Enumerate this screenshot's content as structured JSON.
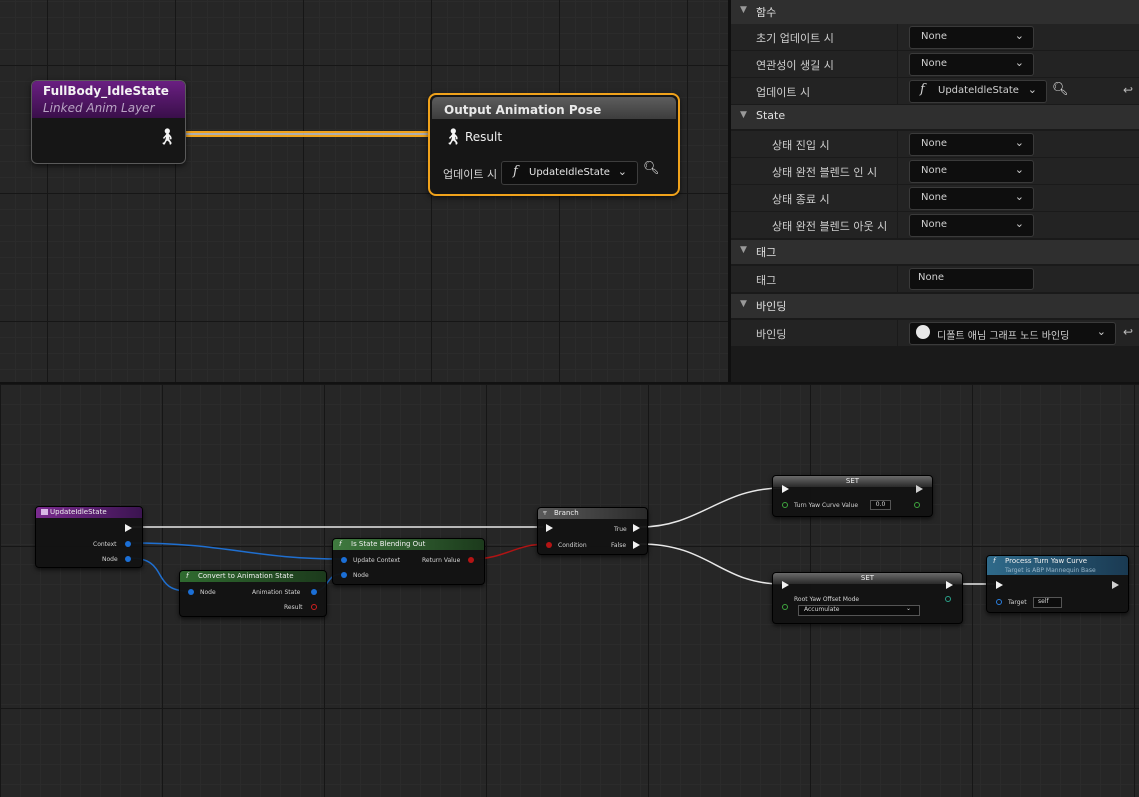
{
  "details": {
    "functions": {
      "section": "함수",
      "rows": [
        {
          "label": "초기 업데이트 시",
          "value": "None"
        },
        {
          "label": "연관성이 생길 시",
          "value": "None"
        },
        {
          "label": "업데이트 시",
          "value": "UpdateIdleState"
        }
      ]
    },
    "state": {
      "section": "State",
      "rows": [
        {
          "label": "상태 진입 시",
          "value": "None"
        },
        {
          "label": "상태 완전 블렌드 인 시",
          "value": "None"
        },
        {
          "label": "상태 종료 시",
          "value": "None"
        },
        {
          "label": "상태 완전 블렌드 아웃 시",
          "value": "None"
        }
      ]
    },
    "tags": {
      "section": "태그",
      "label": "태그",
      "value": "None"
    },
    "binding": {
      "section": "바인딩",
      "label": "바인딩",
      "value": "디폴트 애님 그래프 노드 바인딩"
    }
  },
  "anim_graph": {
    "fullbody_node": {
      "title": "FullBody_IdleState",
      "subtitle": "Linked Anim Layer"
    },
    "output_node": {
      "title": "Output Animation Pose",
      "pin": "Result",
      "update_label": "업데이트 시",
      "update_value": "UpdateIdleState"
    }
  },
  "blueprint": {
    "update_node": {
      "title": "UpdateIdleState",
      "pins": [
        "Context",
        "Node"
      ]
    },
    "convert_node": {
      "title": "Convert to Animation State",
      "in": "Node",
      "out1": "Animation State",
      "out2": "Result"
    },
    "blending_node": {
      "title": "Is State Blending Out",
      "in1": "Update Context",
      "in2": "Node",
      "out": "Return Value"
    },
    "branch_node": {
      "title": "Branch",
      "in": "Condition",
      "out_true": "True",
      "out_false": "False"
    },
    "set1_node": {
      "title": "SET",
      "pin": "Turn Yaw Curve Value",
      "value": "0.0"
    },
    "set2_node": {
      "title": "SET",
      "pin": "Root Yaw Offset Mode",
      "value": "Accumulate"
    },
    "process_node": {
      "title": "Process Turn Yaw Curve",
      "subtitle": "Target is ABP Mannequin Base",
      "pin": "Target",
      "value": "self"
    }
  },
  "colors": {
    "selection": "#f0a21b",
    "linked_layer_header": "#6a1f82",
    "function_header": "#2f5e2f",
    "process_header": "#2a5a7a"
  }
}
